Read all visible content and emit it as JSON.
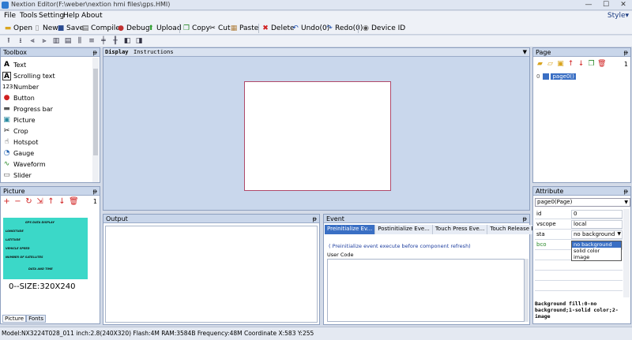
{
  "window": {
    "title": "Nextion Editor(F:\\weber\\nextion hmi files\\gps.HMI)",
    "minimize": "—",
    "maximize": "☐",
    "close": "✕"
  },
  "menu": {
    "items": [
      "File",
      "Tools",
      "Setting",
      "Help",
      "About"
    ],
    "style": "Style▾"
  },
  "toolbar": {
    "open": "Open",
    "new": "New",
    "save": "Save",
    "compile": "Compile",
    "debug": "Debug",
    "upload": "Upload",
    "copy": "Copy",
    "cut": "Cut",
    "paste": "Paste",
    "delete": "Delete",
    "undo": "Undo(0)",
    "redo": "Redo(0)",
    "device_id": "Device  ID"
  },
  "toolbox": {
    "title": "Toolbox",
    "items": [
      "Text",
      "Scrolling text",
      "Number",
      "Button",
      "Progress bar",
      "Picture",
      "Crop",
      "Hotspot",
      "Gauge",
      "Waveform",
      "Slider"
    ]
  },
  "picture_panel": {
    "title": "Picture",
    "count": "1",
    "thumb_lines": [
      "GPS DATA DISPLAY",
      "LONGITUDE",
      "LATITUDE",
      "VEHICLE SPEED",
      "NUMBER OF SATELLITES",
      "DATA AND TIME"
    ],
    "size_label": "0--SIZE:320X240",
    "tabs": [
      "Picture",
      "Fonts"
    ]
  },
  "display": {
    "tabs": [
      "Display",
      "Instructions"
    ]
  },
  "output": {
    "title": "Output"
  },
  "event": {
    "title": "Event",
    "tabs": [
      "Preinitialize Ev...",
      "Postinitialize Eve...",
      "Touch Press Eve...",
      "Touch Release Ev..."
    ],
    "note": "( Preinitialize event execute before component refresh)",
    "user_code_label": "User Code"
  },
  "page_panel": {
    "title": "Page",
    "pages": [
      {
        "num": "0",
        "name": "page0()"
      }
    ],
    "count": "1"
  },
  "attribute": {
    "title": "Attribute",
    "selected": "page0(Page)",
    "rows": [
      {
        "key": "id",
        "value": "0"
      },
      {
        "key": "vscope",
        "value": "local"
      },
      {
        "key": "sta",
        "value": "no background"
      },
      {
        "key": "bco",
        "value": ""
      }
    ],
    "dropdown_options": [
      "no background",
      "solid color",
      "image"
    ],
    "help": "Background fill:0-no background;1-solid color;2-image"
  },
  "status": {
    "text": "Model:NX3224T028_011  inch:2.8(240X320)  Flash:4M  RAM:3584B  Frequency:48M       Coordinate X:583  Y:255"
  },
  "colors": {
    "accent": "#3a6fc4",
    "thumb_bg": "#3bd8c8",
    "canvas_border": "#b04a6a"
  }
}
